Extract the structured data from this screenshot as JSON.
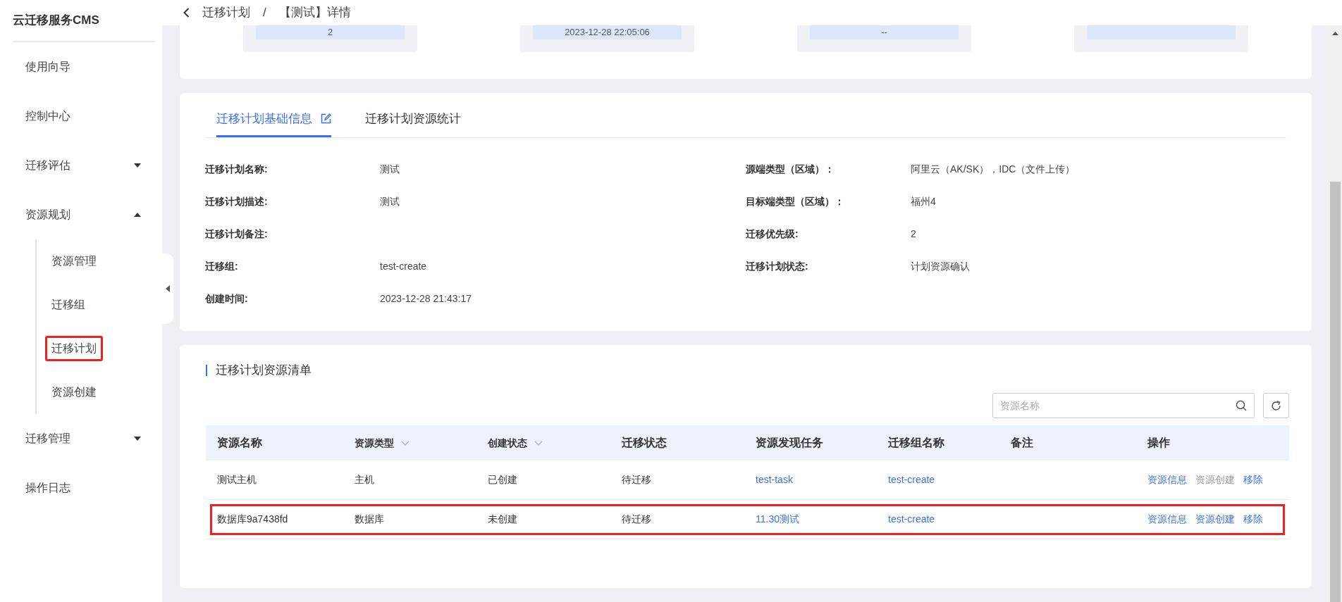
{
  "sidebar": {
    "title": "云迁移服务CMS",
    "items": [
      {
        "label": "使用向导",
        "kind": "link"
      },
      {
        "label": "控制中心",
        "kind": "link"
      },
      {
        "label": "迁移评估",
        "kind": "group",
        "expanded": false
      },
      {
        "label": "资源规划",
        "kind": "group",
        "expanded": true,
        "children": [
          {
            "label": "资源管理",
            "highlighted": false
          },
          {
            "label": "迁移组",
            "highlighted": false
          },
          {
            "label": "迁移计划",
            "highlighted": true
          },
          {
            "label": "资源创建",
            "highlighted": false
          }
        ]
      },
      {
        "label": "迁移管理",
        "kind": "group",
        "expanded": false
      },
      {
        "label": "操作日志",
        "kind": "link"
      }
    ]
  },
  "breadcrumb": {
    "items": [
      "迁移计划",
      "【测试】详情"
    ],
    "separator": "/"
  },
  "stat_boxes": [
    {
      "kind": "value",
      "value": "2"
    },
    {
      "kind": "value",
      "value": "2023-12-28 22:05:06"
    },
    {
      "kind": "value",
      "value": "--"
    },
    {
      "kind": "blank"
    }
  ],
  "tabs": [
    {
      "label": "迁移计划基础信息",
      "selected": true,
      "editable": true
    },
    {
      "label": "迁移计划资源统计",
      "selected": false,
      "editable": false
    }
  ],
  "info": {
    "left": [
      {
        "label": "迁移计划名称:",
        "value": "测试"
      },
      {
        "label": "迁移计划描述:",
        "value": "测试"
      },
      {
        "label": "迁移计划备注:"
      },
      {
        "label": "迁移组:",
        "value": "test-create"
      },
      {
        "label": "创建时间:",
        "value": "2023-12-28 21:43:17"
      }
    ],
    "right": [
      {
        "label": "源端类型（区域）：",
        "value": "阿里云（AK/SK），IDC（文件上传）"
      },
      {
        "label": "目标端类型（区域）：",
        "value": "福州4"
      },
      {
        "label": "迁移优先级:",
        "value": "2"
      },
      {
        "label": "迁移计划状态:",
        "value": "计划资源确认"
      }
    ]
  },
  "resource_list": {
    "title": "迁移计划资源清单",
    "search": {
      "placeholder": "资源名称"
    },
    "columns": [
      {
        "label": "资源名称",
        "sortable": false
      },
      {
        "label": "资源类型",
        "sortable": true
      },
      {
        "label": "创建状态",
        "sortable": true
      },
      {
        "label": "迁移状态",
        "sortable": false
      },
      {
        "label": "资源发现任务",
        "sortable": false
      },
      {
        "label": "迁移组名称",
        "sortable": false
      },
      {
        "label": "备注",
        "sortable": false
      },
      {
        "label": "操作",
        "sortable": false
      }
    ],
    "rows": [
      {
        "highlighted": false,
        "cells": [
          {
            "kind": "text",
            "text": "测试主机"
          },
          {
            "kind": "text",
            "text": "主机"
          },
          {
            "kind": "text",
            "text": "已创建"
          },
          {
            "kind": "text",
            "text": "待迁移"
          },
          {
            "kind": "link",
            "text": "test-task"
          },
          {
            "kind": "link",
            "text": "test-create"
          },
          {
            "kind": "empty"
          }
        ],
        "actions": [
          {
            "label": "资源信息",
            "disabled": false
          },
          {
            "label": "资源创建",
            "disabled": true
          },
          {
            "label": "移除",
            "disabled": false
          }
        ]
      },
      {
        "highlighted": true,
        "cells": [
          {
            "kind": "text",
            "text": "数据库9a7438fd"
          },
          {
            "kind": "text",
            "text": "数据库"
          },
          {
            "kind": "text",
            "text": "未创建"
          },
          {
            "kind": "text",
            "text": "待迁移"
          },
          {
            "kind": "link",
            "text": "11.30测试"
          },
          {
            "kind": "link",
            "text": "test-create"
          },
          {
            "kind": "empty"
          }
        ],
        "actions": [
          {
            "label": "资源信息",
            "disabled": false
          },
          {
            "label": "资源创建",
            "disabled": false
          },
          {
            "label": "移除",
            "disabled": false
          }
        ]
      }
    ]
  }
}
